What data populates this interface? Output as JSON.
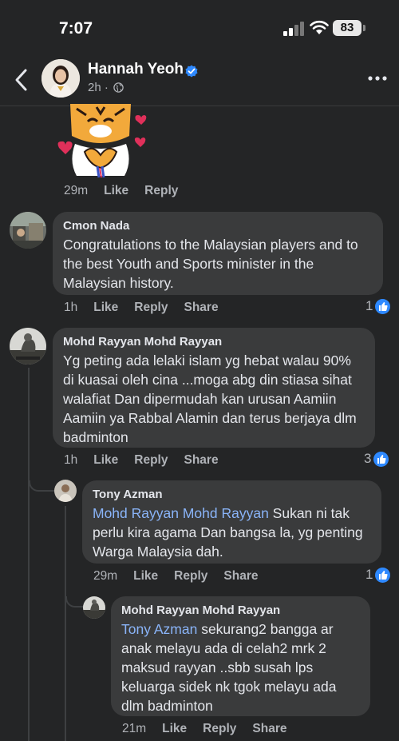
{
  "status_bar": {
    "time": "7:07",
    "battery": "83"
  },
  "header": {
    "page_name": "Hannah Yeoh",
    "post_age": "2h ·",
    "icons": [
      "back-icon",
      "verified-icon",
      "globe-icon",
      "more-icon"
    ]
  },
  "top_comment": {
    "time": "29m",
    "like": "Like",
    "reply": "Reply"
  },
  "comments": [
    {
      "author": "Cmon Nada",
      "text": "Congratulations to the Malaysian players and to the best Youth and Sports minister in the Malaysian history.",
      "time": "1h",
      "like": "Like",
      "reply": "Reply",
      "share": "Share",
      "reactions": "1"
    },
    {
      "author": "Mohd Rayyan Mohd Rayyan",
      "text": "Yg peting ada lelaki islam yg hebat walau 90% di kuasai oleh cina ...moga abg din stiasa sihat walafiat Dan dipermudah kan urusan Aamiin Aamiin ya Rabbal Alamin dan terus berjaya dlm badminton",
      "time": "1h",
      "like": "Like",
      "reply": "Reply",
      "share": "Share",
      "reactions": "3"
    },
    {
      "author": "Tony Azman",
      "mention": "Mohd Rayyan Mohd Rayyan",
      "text": " Sukan ni tak perlu kira agama Dan bangsa la, yg penting Warga Malaysia dah.",
      "time": "29m",
      "like": "Like",
      "reply": "Reply",
      "share": "Share",
      "reactions": "1"
    },
    {
      "author": "Mohd Rayyan Mohd Rayyan",
      "mention": "Tony Azman",
      "text": " sekurang2 bangga ar anak melayu ada di celah2 mrk 2 maksud rayyan ..sbb susah lps keluarga sidek nk tgok melayu ada dlm badminton",
      "time": "21m",
      "like": "Like",
      "reply": "Reply",
      "share": "Share"
    }
  ],
  "colors": {
    "background": "#242526",
    "bubble": "#3a3b3c",
    "mention": "#8ab4f8",
    "like_badge": "#2e89ff",
    "verified": "#2e89ff"
  }
}
